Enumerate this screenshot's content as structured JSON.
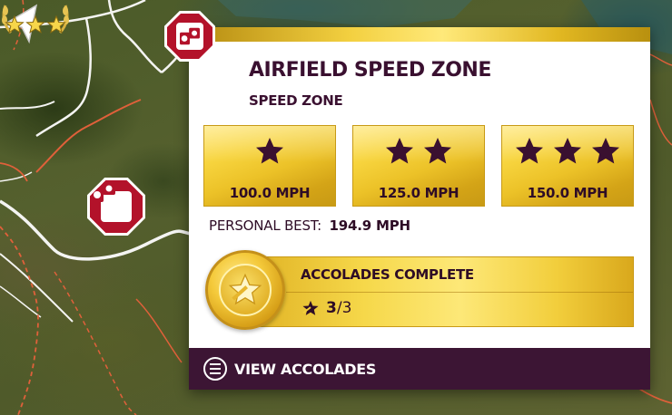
{
  "event": {
    "title": "AIRFIELD SPEED ZONE",
    "type": "SPEED ZONE",
    "badge_icon": "speed-camera-icon"
  },
  "tiers": [
    {
      "stars": 1,
      "value": "100.0 MPH"
    },
    {
      "stars": 2,
      "value": "125.0 MPH"
    },
    {
      "stars": 3,
      "value": "150.0 MPH"
    }
  ],
  "personal_best": {
    "label": "PERSONAL BEST:",
    "value": "194.9 MPH"
  },
  "accolades": {
    "label": "ACCOLADES COMPLETE",
    "completed": "3",
    "total": "/3",
    "icon": "accolade-star-icon"
  },
  "footer": {
    "label": "VIEW ACCOLADES",
    "icon": "menu-circle-icon"
  },
  "map_marker": {
    "icon": "speed-camera-icon",
    "stars_earned": 3
  },
  "colors": {
    "brand_purple": "#3c1534",
    "gold": "#f3d040",
    "marker_red": "#b3122a",
    "route_orange": "#e0603a"
  }
}
